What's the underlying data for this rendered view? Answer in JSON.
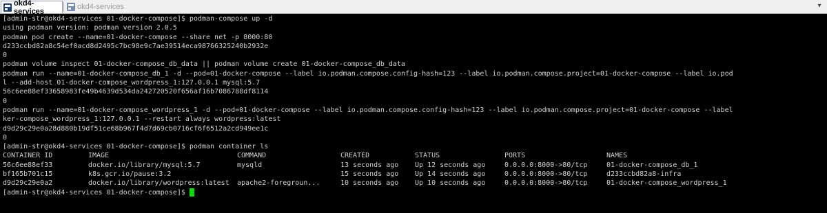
{
  "tabs": [
    {
      "label": "okd4-services",
      "active": true
    },
    {
      "label": "okd4-services",
      "active": false
    }
  ],
  "colors": {
    "terminal_bg": "#000000",
    "terminal_fg": "#d0d0d0",
    "cursor": "#00e000"
  },
  "terminal": {
    "lines": [
      "[admin-str@okd4-services 01-docker-compose]$ podman-compose up -d",
      "using podman version: podman version 2.0.5",
      "podman pod create --name=01-docker-compose --share net -p 8000:80",
      "d233ccbd82a8c54ef0acd8d2495c7bc98e9c7ae39514eca98766325240b2932e",
      "0",
      "podman volume inspect 01-docker-compose_db_data || podman volume create 01-docker-compose_db_data",
      "podman run --name=01-docker-compose_db_1 -d --pod=01-docker-compose --label io.podman.compose.config-hash=123 --label io.podman.compose.project=01-docker-compose --label io.pod",
      "l --add-host 01-docker-compose_wordpress_1:127.0.0.1 mysql:5.7",
      "56c6ee88ef33658983fe49b4639d534da242720520f656af16b7086788df8114",
      "0",
      "podman run --name=01-docker-compose_wordpress_1 -d --pod=01-docker-compose --label io.podman.compose.config-hash=123 --label io.podman.compose.project=01-docker-compose --label",
      "ker-compose_wordpress_1:127.0.0.1 --restart always wordpress:latest",
      "d9d29c29e0a28d880b19df51ce68b967f4d7d69cb0716cf6f6512a2cd949ee1c",
      "0",
      "[admin-str@okd4-services 01-docker-compose]$ podman container ls"
    ],
    "table": {
      "headers": [
        "CONTAINER ID",
        "IMAGE",
        "COMMAND",
        "CREATED",
        "STATUS",
        "PORTS",
        "NAMES"
      ],
      "rows": [
        [
          "56c6ee88ef33",
          "docker.io/library/mysql:5.7",
          "mysqld",
          "13 seconds ago",
          "Up 12 seconds ago",
          "0.0.0.0:8000->80/tcp",
          "01-docker-compose_db_1"
        ],
        [
          "bf165b701c15",
          "k8s.gcr.io/pause:3.2",
          "",
          "15 seconds ago",
          "Up 14 seconds ago",
          "0.0.0.0:8000->80/tcp",
          "d233ccbd82a8-infra"
        ],
        [
          "d9d29c29e0a2",
          "docker.io/library/wordpress:latest",
          "apache2-foregroun...",
          "10 seconds ago",
          "Up 10 seconds ago",
          "0.0.0.0:8000->80/tcp",
          "01-docker-compose_wordpress_1"
        ]
      ]
    },
    "final_prompt": "[admin-str@okd4-services 01-docker-compose]$"
  }
}
